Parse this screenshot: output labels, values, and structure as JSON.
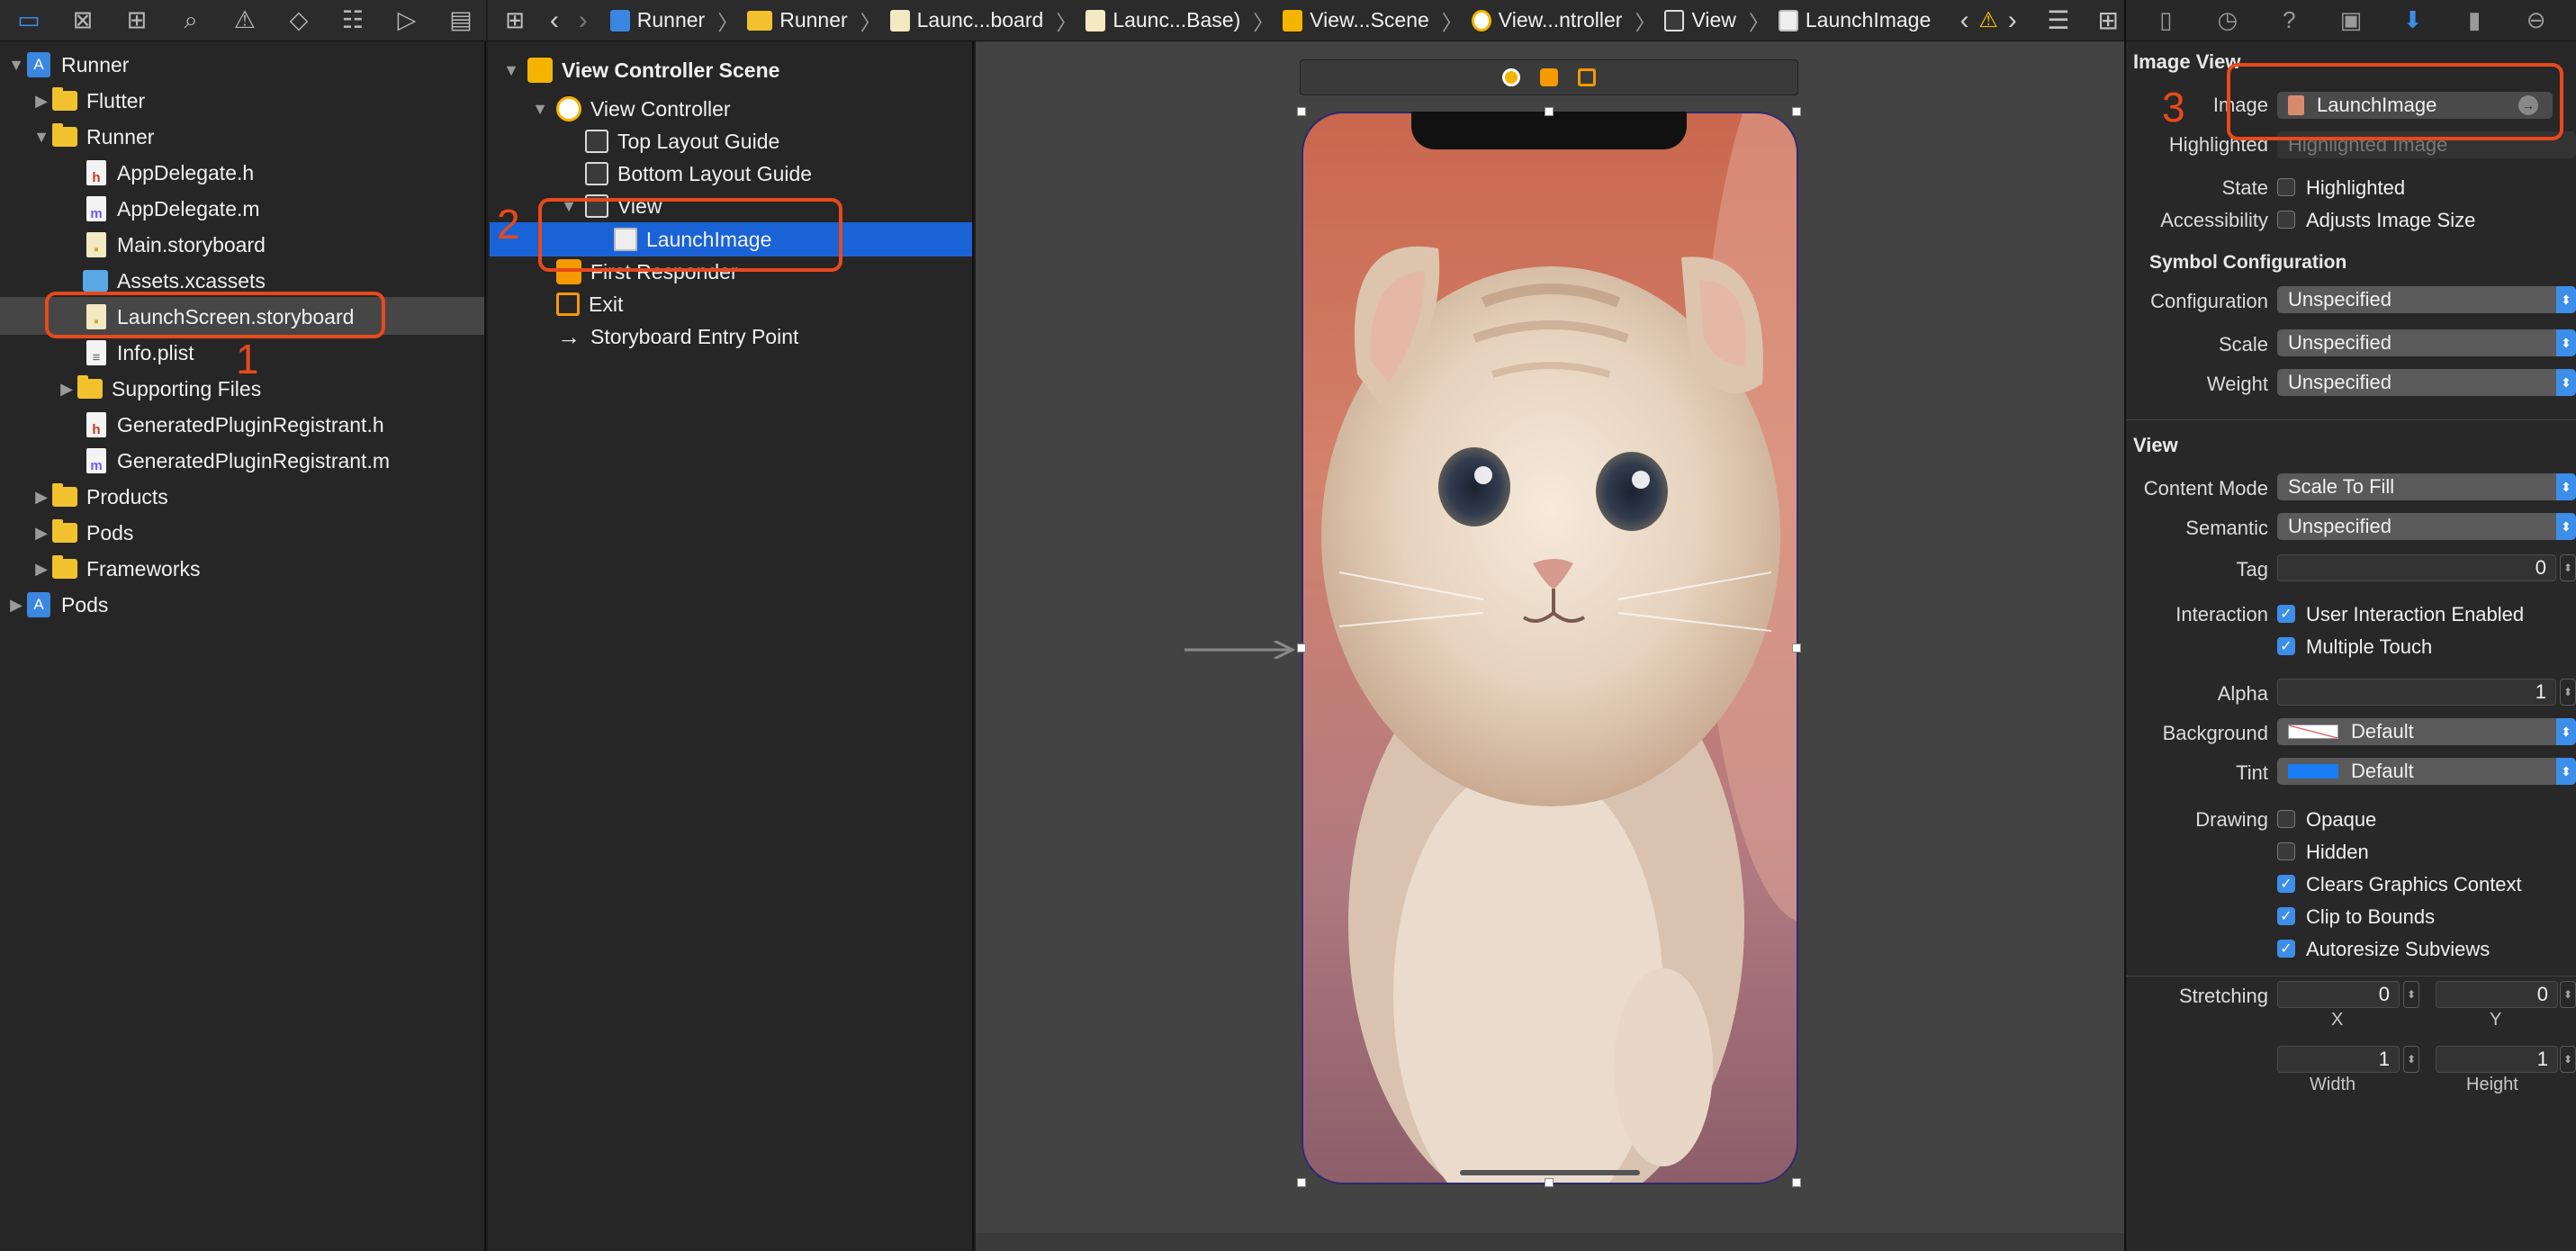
{
  "navigator": {
    "toolbar_icons": [
      "folder-icon",
      "source-control-icon",
      "symbol-icon",
      "find-icon",
      "issue-icon",
      "test-icon",
      "debug-icon",
      "breakpoint-icon",
      "report-icon"
    ],
    "items": [
      {
        "label": "Runner",
        "kind": "project",
        "level": 0,
        "expanded": true
      },
      {
        "label": "Flutter",
        "kind": "folder",
        "level": 1,
        "expanded": false
      },
      {
        "label": "Runner",
        "kind": "folder",
        "level": 1,
        "expanded": true
      },
      {
        "label": "AppDelegate.h",
        "kind": "h",
        "level": 2
      },
      {
        "label": "AppDelegate.m",
        "kind": "m",
        "level": 2
      },
      {
        "label": "Main.storyboard",
        "kind": "storyboard",
        "level": 2
      },
      {
        "label": "Assets.xcassets",
        "kind": "assets",
        "level": 2
      },
      {
        "label": "LaunchScreen.storyboard",
        "kind": "storyboard",
        "level": 2,
        "selected": true
      },
      {
        "label": "Info.plist",
        "kind": "plist",
        "level": 2
      },
      {
        "label": "Supporting Files",
        "kind": "folder",
        "level": 2,
        "expanded": false
      },
      {
        "label": "GeneratedPluginRegistrant.h",
        "kind": "h",
        "level": 2
      },
      {
        "label": "GeneratedPluginRegistrant.m",
        "kind": "m",
        "level": 2
      },
      {
        "label": "Products",
        "kind": "folder",
        "level": 1,
        "expanded": false
      },
      {
        "label": "Pods",
        "kind": "folder",
        "level": 1,
        "expanded": false
      },
      {
        "label": "Frameworks",
        "kind": "folder",
        "level": 1,
        "expanded": false
      },
      {
        "label": "Pods",
        "kind": "project",
        "level": 0,
        "expanded": false
      }
    ]
  },
  "breadcrumb": {
    "items": [
      "Runner",
      "Runner",
      "Launc...board",
      "Launc...Base)",
      "View...Scene",
      "View...ntroller",
      "View",
      "LaunchImage"
    ]
  },
  "outline": {
    "items": [
      {
        "label": "View Controller Scene",
        "level": 0,
        "icon": "scene"
      },
      {
        "label": "View Controller",
        "level": 1,
        "icon": "controller"
      },
      {
        "label": "Top Layout Guide",
        "level": 2,
        "icon": "guide"
      },
      {
        "label": "Bottom Layout Guide",
        "level": 2,
        "icon": "guide"
      },
      {
        "label": "View",
        "level": 2,
        "icon": "view"
      },
      {
        "label": "LaunchImage",
        "level": 3,
        "icon": "image",
        "selected": true
      },
      {
        "label": "First Responder",
        "level": 1,
        "icon": "responder"
      },
      {
        "label": "Exit",
        "level": 1,
        "icon": "exit"
      },
      {
        "label": "Storyboard Entry Point",
        "level": 1,
        "icon": "entry"
      }
    ]
  },
  "annotations": [
    "1",
    "2",
    "3"
  ],
  "inspector": {
    "image_view_title": "Image View",
    "image_label": "Image",
    "image_value": "LaunchImage",
    "highlighted_label": "Highlighted",
    "highlighted_placeholder": "Highlighted Image",
    "state_label": "State",
    "state_option": "Highlighted",
    "accessibility_label": "Accessibility",
    "accessibility_option": "Adjusts Image Size",
    "symbol_title": "Symbol Configuration",
    "configuration_label": "Configuration",
    "configuration_value": "Unspecified",
    "scale_label": "Scale",
    "scale_value": "Unspecified",
    "weight_label": "Weight",
    "weight_value": "Unspecified",
    "view_title": "View",
    "content_mode_label": "Content Mode",
    "content_mode_value": "Scale To Fill",
    "semantic_label": "Semantic",
    "semantic_value": "Unspecified",
    "tag_label": "Tag",
    "tag_value": "0",
    "interaction_label": "Interaction",
    "user_interaction": "User Interaction Enabled",
    "multiple_touch": "Multiple Touch",
    "alpha_label": "Alpha",
    "alpha_value": "1",
    "background_label": "Background",
    "background_value": "Default",
    "tint_label": "Tint",
    "tint_value": "Default",
    "drawing_label": "Drawing",
    "opaque": "Opaque",
    "hidden": "Hidden",
    "clears": "Clears Graphics Context",
    "clip": "Clip to Bounds",
    "autoresize": "Autoresize Subviews",
    "stretching_label": "Stretching",
    "stretch_x": "0",
    "stretch_y": "0",
    "stretch_w": "1",
    "stretch_h": "1",
    "x_label": "X",
    "y_label": "Y",
    "width_label": "Width",
    "height_label": "Height",
    "tint_color": "#1a7cf5"
  }
}
